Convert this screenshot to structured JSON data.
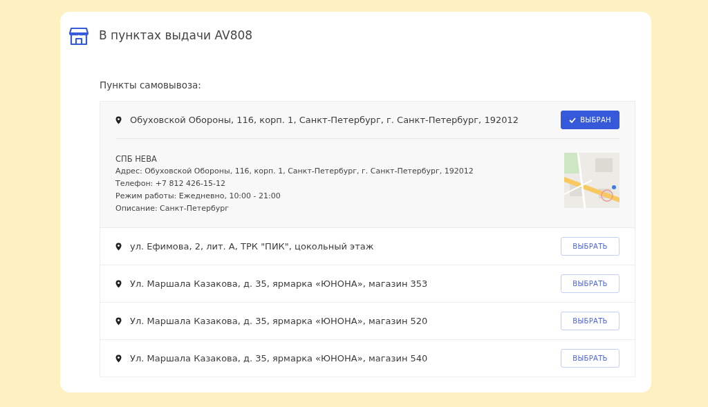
{
  "header": {
    "title": "В пунктах выдачи AV808"
  },
  "subtitle": "Пункты самовывоза:",
  "points": [
    {
      "address": "Обуховской Обороны, 116, корп. 1, Санкт-Петербург, г. Санкт-Петербург, 192012",
      "selected": true,
      "button": "ВЫБРАН",
      "details": [
        "СПБ НЕВА",
        "Адрес: Обуховской Обороны, 116, корп. 1, Санкт-Петербург, г. Санкт-Петербург, 192012",
        "Телефон: +7 812 426-15-12",
        "Режим работы: Ежедневно, 10:00 - 21:00",
        "Описание: Санкт-Петербург"
      ]
    },
    {
      "address": "ул. Ефимова, 2, лит. А, ТРК \"ПИК\", цокольный этаж",
      "selected": false,
      "button": "ВЫБРАТЬ"
    },
    {
      "address": "Ул. Маршала Казакова, д. 35, ярмарка «ЮНОНА», магазин 353",
      "selected": false,
      "button": "ВЫБРАТЬ"
    },
    {
      "address": "Ул. Маршала Казакова, д. 35, ярмарка «ЮНОНА», магазин 520",
      "selected": false,
      "button": "ВЫБРАТЬ"
    },
    {
      "address": "Ул. Маршала Казакова, д. 35, ярмарка «ЮНОНА», магазин 540",
      "selected": false,
      "button": "ВЫБРАТЬ"
    }
  ]
}
